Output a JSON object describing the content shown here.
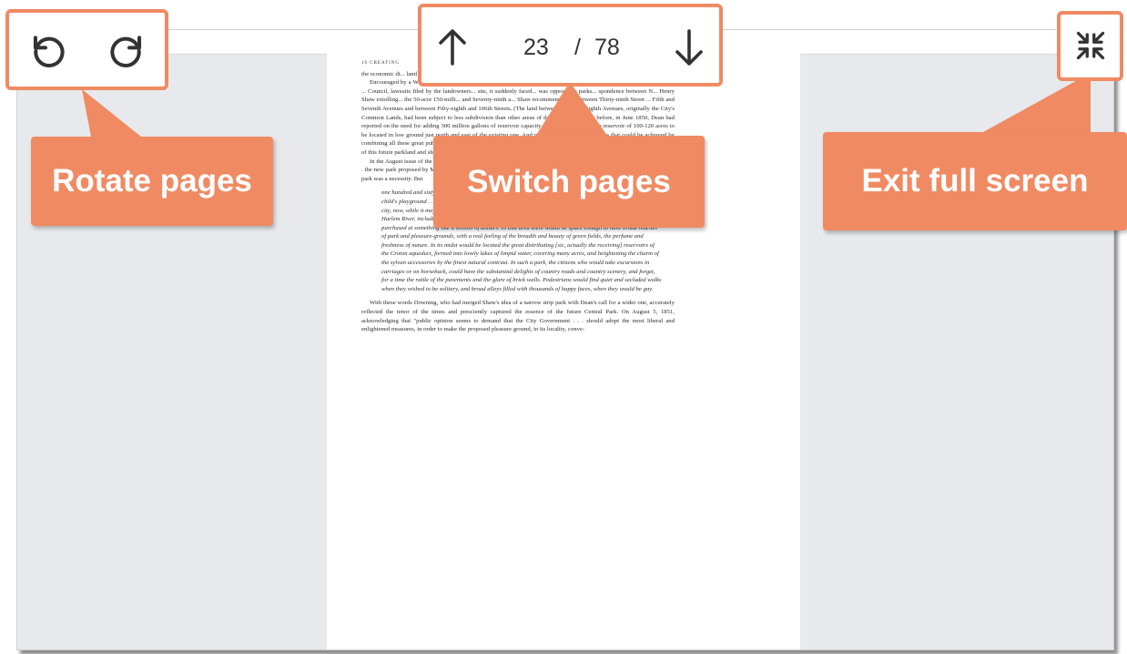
{
  "toolbar": {
    "current_page": "23",
    "page_separator": "/",
    "total_pages": "78",
    "rotate_left_icon": "rotate-counterclockwise-icon",
    "rotate_right_icon": "rotate-clockwise-icon",
    "prev_icon": "arrow-up-icon",
    "next_icon": "arrow-down-icon",
    "exit_icon": "exit-fullscreen-icon"
  },
  "callouts": {
    "rotate": "Rotate pages",
    "switch": "Switch pages",
    "exit": "Exit full screen"
  },
  "colors": {
    "accent": "#f08a63",
    "viewer_bg": "#e8e9ec",
    "page_bg": "#ffffff"
  },
  "document": {
    "running_head": "16 CREATING",
    "para1": "the economic di... land might be only modestly compensated, even if the value of adjacent properties were to rise hugely.",
    "para2": "Encouraged by a Whig-dominated Assembly, the J... had initially encountered smooth sailing. But faced with a Democratic ... Council, lawsuits filed by the landowners... site, it suddenly faced... was opposed to parks... spondence between N... Henry Shaw extolling... the 50-acre 150-milli... and Seventy-ninth a... Shaw recommended a... between Thirty-ninth Street ... Fifth and Seventh Avenues and between Fifty-eighth and 106th Streets. (The land between Fifth and Eighth Avenues, originally the City's Common Lands, had been subject to less subdivision than other areas of the island.) The year before, in June 1850, Dean had reported on the need for adding 300 million gallons of reservoir capacity, recommending a single reservoir of 100-120 acres to be located in low ground just north and east of the existing one. And now he praised the economies that could be achieved by combining all these great public works within one \"Central Park.\" The Dripps map (see fig. 7) identifies the major landowners of this future parkland and shows some of the subdivisions and buildings thereon.",
    "para3": "In the August issue of the Horticulturist Downing addressed, passionately and at length, \"the leading topic of town gossip, . . . the new park proposed by Mayor Kingsland.\" He was pleased that, finally, New York had awakened and realized that the new park was a necessity. But",
    "quote": "one hundred and sixty acres of park for a city that will soon contain three-quarters of a million people! It is only a child's playground . . . Five hundred acres is the smallest area that should be reserved for the future want of such a city, now, while it may be obtained. Five hundred acres may be selected between Thirty-ninth-street and the Harlem River, including a varied surface of land, a good deal of which is yet waste area, so that the whole may be purchased at something like a million of dollars. In that area there would be space enough to have broad reaches of park and pleasure-grounds, with a real feeling of the breadth and beauty of green fields, the perfume and freshness of nature. In its midst would be located the great distributing [sic, actually the receiving] reservoirs of the Croton aqueduct, formed into lovely lakes of limpid water, covering many acres, and heightening the charm of the sylvan accessories by the finest natural contrast. In such a park, the citizens who would take excursions in carriages or on horseback, could have the substantial delights of country roads and country scenery, and forget, for a time the rattle of the pavements and the glare of brick walls. Pedestrians would find quiet and secluded walks when they wished to be solitary, and broad alleys filled with thousands of happy faces, when they would be gay.",
    "para4": "With these words Downing, who had merged Shaw's idea of a narrow strip park with Dean's call for a wider one, accurately reflected the tenor of the times and presciently captured the essence of the future Central Park. On August 5, 1851, acknowledging that \"public opinion seems to demand that the City Government . . . should adopt the most liberal and enlightened measures, in order to make the proposed pleasure ground, in its locality, conve-"
  }
}
